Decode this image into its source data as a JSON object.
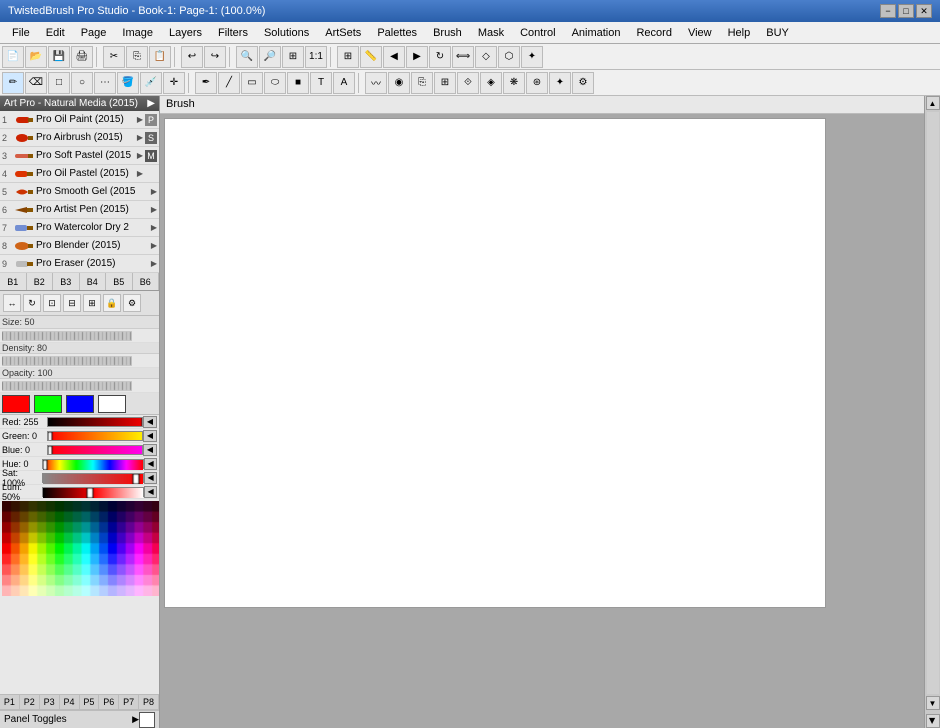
{
  "titlebar": {
    "title": "TwistedBrush Pro Studio - Book-1: Page-1: (100.0%)",
    "min_btn": "−",
    "max_btn": "□",
    "close_btn": "✕"
  },
  "menubar": {
    "items": [
      "File",
      "Edit",
      "Page",
      "Image",
      "Layers",
      "Filters",
      "Solutions",
      "ArtSets",
      "Palettes",
      "Brush",
      "Mask",
      "Control",
      "Animation",
      "Record",
      "View",
      "Help",
      "BUY"
    ]
  },
  "toolbar1": {
    "buttons": [
      "📄",
      "📂",
      "💾",
      "🖨",
      "✂",
      "📋",
      "📋",
      "↩",
      "↪",
      "🔍",
      "🔍",
      "🔍",
      "🔍",
      "📐",
      "📐"
    ]
  },
  "toolbar2": {
    "buttons": [
      "✏",
      "✏",
      "□",
      "△",
      "●",
      "○",
      "◉",
      "⬛",
      "⬡",
      "〰",
      "〰",
      "Σ",
      "T",
      "A",
      "⚙",
      "◉",
      "⋯",
      "⋯",
      "⋯",
      "⋯",
      "⋯",
      "⋯"
    ]
  },
  "brush_label": "Brush",
  "panel_header": "Art Pro - Natural Media (2015)",
  "brushes": [
    {
      "num": "1",
      "name": "Pro Oil Paint (2015)",
      "letter": "P"
    },
    {
      "num": "2",
      "name": "Pro Airbrush (2015)",
      "letter": "S"
    },
    {
      "num": "3",
      "name": "Pro Soft Pastel (2015",
      "letter": "M"
    },
    {
      "num": "4",
      "name": "Pro Oil Pastel (2015)",
      "letter": ""
    },
    {
      "num": "5",
      "name": "Pro Smooth Gel (2015)",
      "letter": ""
    },
    {
      "num": "6",
      "name": "Pro Artist Pen (2015)",
      "letter": ""
    },
    {
      "num": "7",
      "name": "Pro Watercolor Dry 2",
      "letter": ""
    },
    {
      "num": "8",
      "name": "Pro Blender (2015)",
      "letter": ""
    },
    {
      "num": "9",
      "name": "Pro Eraser (2015)",
      "letter": ""
    }
  ],
  "brush_tabs": [
    "B1",
    "B2",
    "B3",
    "B4",
    "B5",
    "B6"
  ],
  "size_label": "Size: 50",
  "density_label": "Density: 80",
  "opacity_label": "Opacity: 100",
  "color": {
    "red_label": "Red: 255",
    "green_label": "Green: 0",
    "blue_label": "Blue: 0",
    "hue_label": "Hue: 0",
    "sat_label": "Sat: 100%",
    "lum_label": "Lum: 50%"
  },
  "p_tabs": [
    "P1",
    "P2",
    "P3",
    "P4",
    "P5",
    "P6",
    "P7",
    "P8"
  ],
  "panel_toggles": "Panel Toggles"
}
